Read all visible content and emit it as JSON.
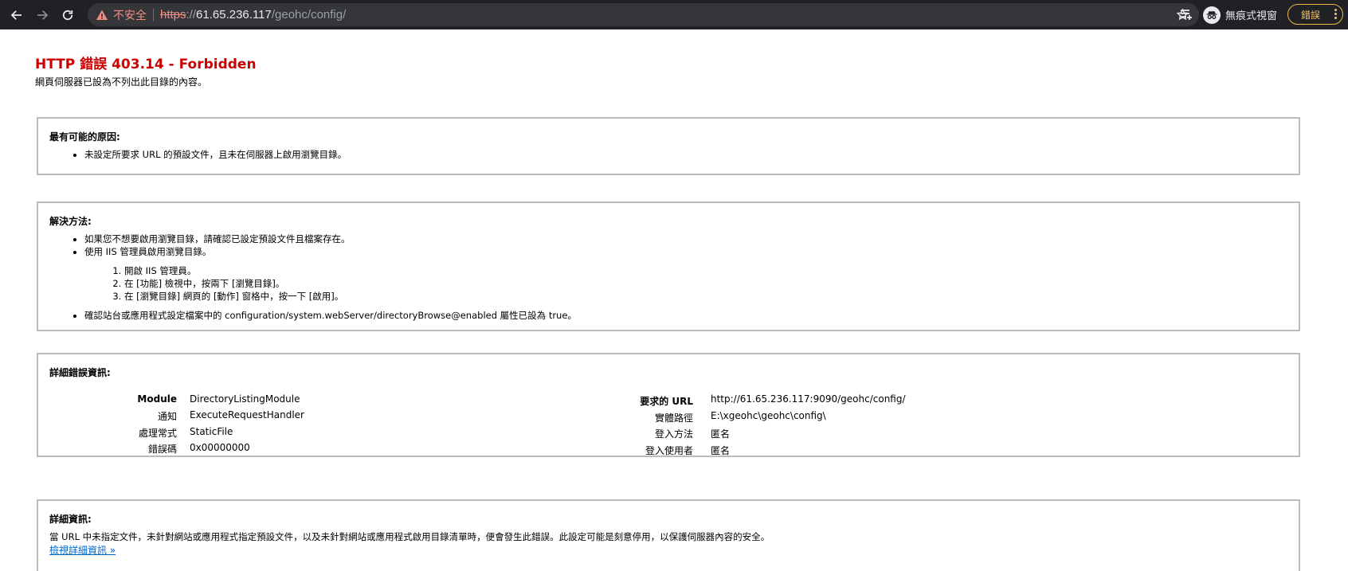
{
  "browser": {
    "security_label": "不安全",
    "url": {
      "scheme": "https",
      "separator": "://",
      "host": "61.65.236.117",
      "path": "/geohc/config/"
    },
    "incognito_label": "無痕式視窗",
    "error_chip": "錯誤",
    "icons": [
      "back-arrow-icon",
      "forward-arrow-icon",
      "reload-icon",
      "warning-icon",
      "star-icon",
      "reading-list-icon",
      "incognito-icon",
      "more-vert-icon"
    ],
    "colors": {
      "toolbar": "#202124",
      "omnibox": "#35363a",
      "warning": "#f28b82",
      "error_chip": "#f6c26b"
    }
  },
  "page": {
    "title": "HTTP 錯誤 403.14 - Forbidden",
    "subtitle": "網頁伺服器已設為不列出此目錄的內容。",
    "title_color": "#cc0000",
    "causes": {
      "heading": "最有可能的原因:",
      "items": [
        "未設定所要求 URL 的預設文件，且未在伺服器上啟用瀏覽目錄。"
      ]
    },
    "solutions": {
      "heading": "解決方法:",
      "items": [
        "如果您不想要啟用瀏覽目錄，請確認已設定預設文件且檔案存在。",
        "使用 IIS 管理員啟用瀏覽目錄。"
      ],
      "steps": [
        "開啟 IIS 管理員。",
        "在 [功能] 檢視中，按兩下 [瀏覽目錄]。",
        "在 [瀏覽目錄] 網頁的 [動作] 窗格中，按一下 [啟用]。"
      ],
      "last_item": "確認站台或應用程式設定檔案中的 configuration/system.webServer/directoryBrowse@enabled 屬性已設為 true。"
    },
    "details": {
      "heading": "詳細錯誤資訊:",
      "left": [
        {
          "label": "Module",
          "value": "DirectoryListingModule"
        },
        {
          "label": "通知",
          "value": "ExecuteRequestHandler"
        },
        {
          "label": "處理常式",
          "value": "StaticFile"
        },
        {
          "label": "錯誤碼",
          "value": "0x00000000"
        }
      ],
      "right": [
        {
          "label": "要求的 URL",
          "value": "http://61.65.236.117:9090/geohc/config/"
        },
        {
          "label": "實體路徑",
          "value": "E:\\xgeohc\\geohc\\config\\"
        },
        {
          "label": "登入方法",
          "value": "匿名"
        },
        {
          "label": "登入使用者",
          "value": "匿名"
        }
      ]
    },
    "more_info": {
      "heading": "詳細資訊:",
      "text": "當 URL 中未指定文件，未針對網站或應用程式指定預設文件，以及未針對網站或應用程式啟用目錄清單時，便會發生此錯誤。此設定可能是刻意停用，以保護伺服器內容的安全。",
      "link": "檢視詳細資訊 »"
    }
  }
}
